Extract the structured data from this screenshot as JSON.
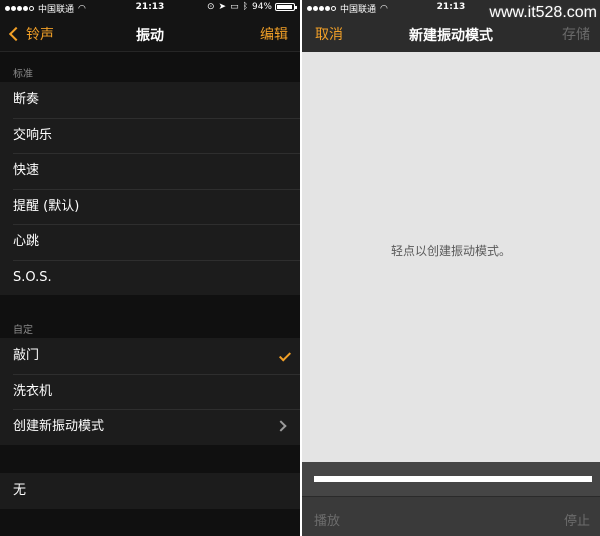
{
  "left": {
    "status": {
      "carrier": "中国联通",
      "time": "21:13",
      "battery": "94%",
      "battery_level": 0.94
    },
    "nav": {
      "back_label": "铃声",
      "title": "振动",
      "edit_label": "编辑"
    },
    "standard": {
      "header": "标准",
      "items": [
        "断奏",
        "交响乐",
        "快速",
        "提醒 (默认)",
        "心跳",
        "S.O.S."
      ]
    },
    "custom": {
      "header": "自定",
      "items": [
        "敲门",
        "洗衣机",
        "创建新振动模式"
      ]
    },
    "none": {
      "label": "无"
    }
  },
  "right": {
    "status": {
      "carrier": "中国联通",
      "time": "21:13",
      "battery": "94%",
      "battery_level": 0.94
    },
    "nav": {
      "cancel_label": "取消",
      "title": "新建振动模式",
      "save_label": "存储"
    },
    "hint": "轻点以创建振动模式。",
    "bottom": {
      "play_label": "播放",
      "stop_label": "停止"
    }
  },
  "watermark": "www.it528.com"
}
